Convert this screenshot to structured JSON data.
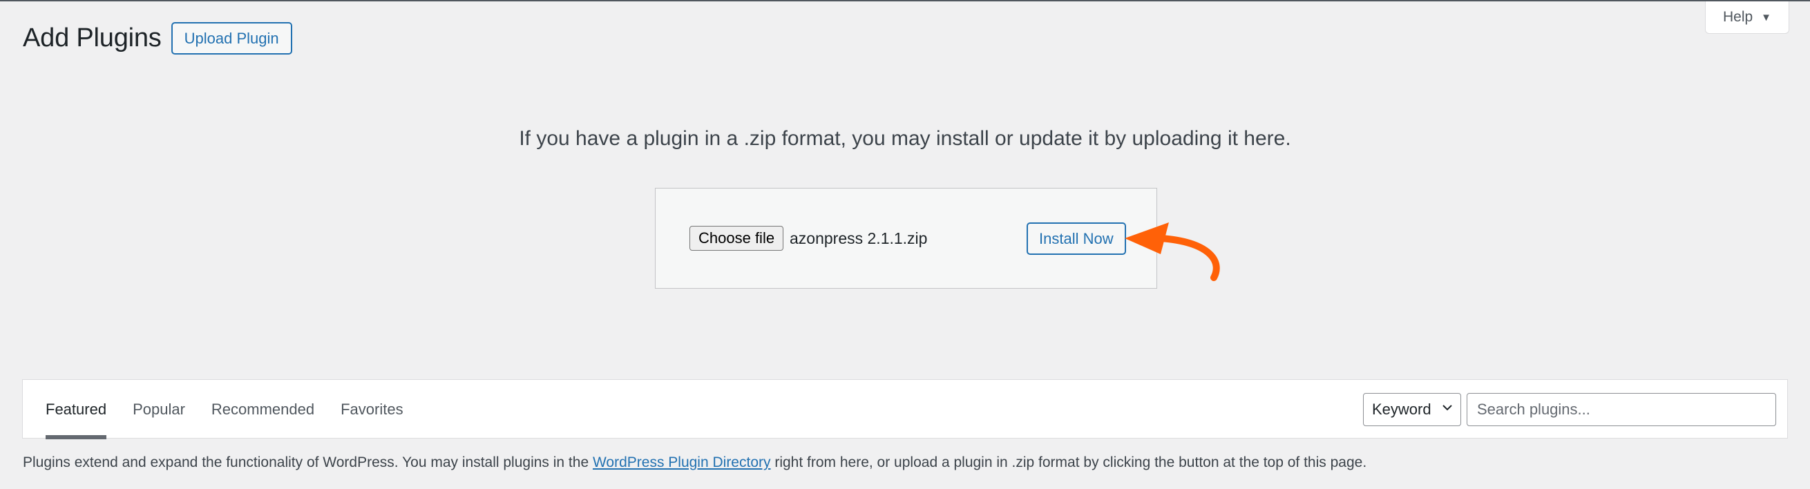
{
  "header": {
    "title": "Add Plugins",
    "upload_button": "Upload Plugin"
  },
  "help": {
    "label": "Help",
    "caret": "▼"
  },
  "upload": {
    "description": "If you have a plugin in a .zip format, you may install or update it by uploading it here.",
    "choose_file_label": "Choose file",
    "file_name": "azonpress 2.1.1.zip",
    "install_button": "Install Now"
  },
  "annotation": {
    "arrow_color": "#ff6108"
  },
  "filters": {
    "tabs": [
      {
        "label": "Featured",
        "current": true
      },
      {
        "label": "Popular",
        "current": false
      },
      {
        "label": "Recommended",
        "current": false
      },
      {
        "label": "Favorites",
        "current": false
      }
    ]
  },
  "search": {
    "type_selected": "Keyword",
    "placeholder": "Search plugins..."
  },
  "info": {
    "before": "Plugins extend and expand the functionality of WordPress. You may install plugins in the ",
    "link": "WordPress Plugin Directory",
    "after": " right from here, or upload a plugin in .zip format by clicking the button at the top of this page."
  },
  "colors": {
    "accent": "#2271b1",
    "background": "#f0f0f1"
  }
}
